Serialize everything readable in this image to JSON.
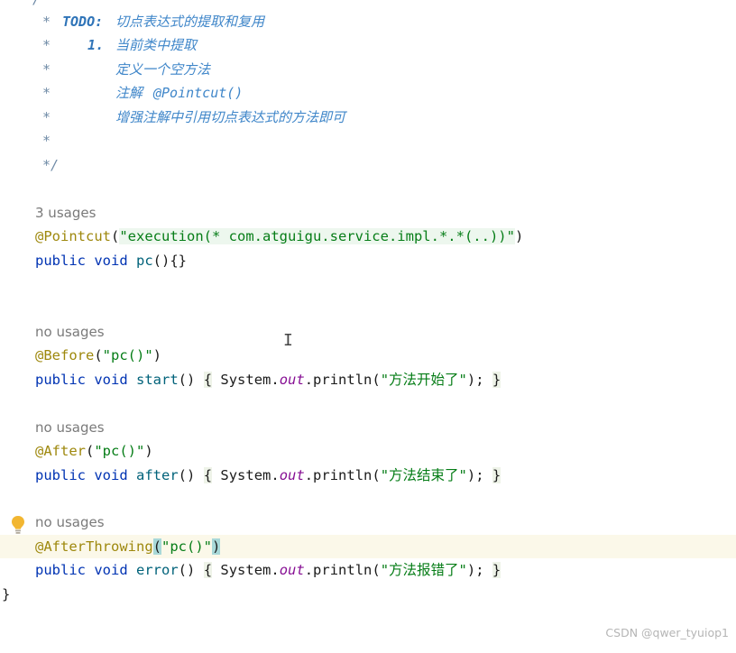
{
  "comment": {
    "star": "*",
    "close": "*/",
    "todo_label": "TODO:",
    "todo_text": "切点表达式的提取和复用",
    "item1_num": "1.",
    "item1_text": "当前类中提取",
    "line3": "定义一个空方法",
    "line4_prefix": "注解",
    "line4_code": "@Pointcut()",
    "line5": "增强注解中引用切点表达式的方法即可"
  },
  "pointcut": {
    "usages": "3 usages",
    "annotation": "@Pointcut",
    "expression": "\"execution(* com.atguigu.service.impl.*.*(..))\"",
    "signature_kw": "public void",
    "method": "pc",
    "body": "(){}"
  },
  "before": {
    "usages": "no usages",
    "annotation": "@Before",
    "arg": "\"pc()\"",
    "method": "start",
    "message": "\"方法开始了\""
  },
  "after": {
    "usages": "no usages",
    "annotation": "@After",
    "arg": "\"pc()\"",
    "method": "after",
    "message": "\"方法结束了\""
  },
  "afterThrowing": {
    "usages": "no usages",
    "annotation": "@AfterThrowing",
    "arg": "\"pc()\"",
    "method": "error",
    "message": "\"方法报错了\""
  },
  "common": {
    "kw_public_void": "public void",
    "system": "System.",
    "out": "out",
    "println": ".println(",
    "paren_open": "(",
    "paren_close": ")",
    "parens": "()",
    "brace_open": "{",
    "brace_close": "}",
    "stmt_end": ");",
    "class_close": "}",
    "top_cut": "/**"
  },
  "cursor_glyph": "I",
  "watermark": "CSDN @qwer_tyuiop1",
  "colors": {
    "annotation": "#9e880d",
    "keyword": "#0033b3",
    "string": "#067d17",
    "comment": "#6e8aa6",
    "field": "#871094"
  }
}
